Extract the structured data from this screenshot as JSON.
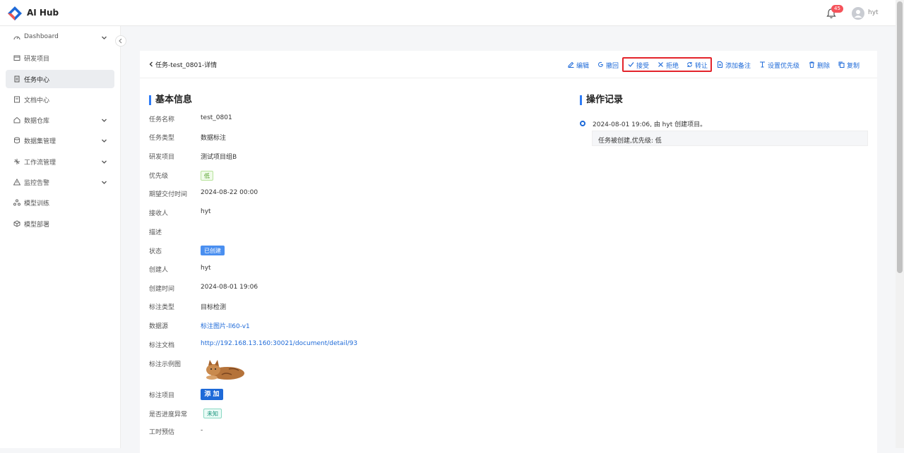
{
  "app": {
    "title": "AI Hub"
  },
  "header": {
    "badge": "45",
    "user": "hyt"
  },
  "sidebar": {
    "items": [
      {
        "label": "Dashboard"
      },
      {
        "label": "研发项目"
      },
      {
        "label": "任务中心"
      },
      {
        "label": "文档中心"
      },
      {
        "label": "数据仓库"
      },
      {
        "label": "数据集管理"
      },
      {
        "label": "工作流管理"
      },
      {
        "label": "监控告警"
      },
      {
        "label": "模型训练"
      },
      {
        "label": "模型部署"
      }
    ]
  },
  "page": {
    "title": "任务-test_0801-详情"
  },
  "actions": {
    "edit": "编辑",
    "revoke": "撤回",
    "accept": "接受",
    "reject": "拒绝",
    "transfer": "转让",
    "add_note": "添加备注",
    "set_priority": "设置优先级",
    "delete": "删除",
    "copy": "复制"
  },
  "basic": {
    "section_title": "基本信息",
    "rows": [
      {
        "label": "任务名称",
        "value": "test_0801"
      },
      {
        "label": "任务类型",
        "value": "数据标注"
      },
      {
        "label": "研发项目",
        "value": "测试项目组B"
      },
      {
        "label": "优先级",
        "value": "低"
      },
      {
        "label": "期望交付时间",
        "value": "2024-08-22 00:00"
      },
      {
        "label": "接收人",
        "value": "hyt"
      },
      {
        "label": "描述",
        "value": ""
      },
      {
        "label": "状态",
        "value": "已创建"
      },
      {
        "label": "创建人",
        "value": "hyt"
      },
      {
        "label": "创建时间",
        "value": "2024-08-01 19:06"
      },
      {
        "label": "标注类型",
        "value": "目标检测"
      },
      {
        "label": "数据源",
        "value": "标注图片-ll60-v1"
      },
      {
        "label": "标注文档",
        "value": "http://192.168.13.160:30021/document/detail/93"
      },
      {
        "label": "标注示例图",
        "value": ""
      },
      {
        "label": "标注项目",
        "value": "添 加"
      },
      {
        "label": "是否进度异常",
        "value": "未知"
      },
      {
        "label": "工时预估",
        "value": "-"
      }
    ]
  },
  "log": {
    "section_title": "操作记录",
    "entries": [
      {
        "time": "2024-08-01 19:06, 由 hyt 创建项目。",
        "message": "任务被创建,优先级: 低"
      }
    ]
  },
  "colors": {
    "accent": "#1e6ad8",
    "highlight": "#e3242b"
  }
}
